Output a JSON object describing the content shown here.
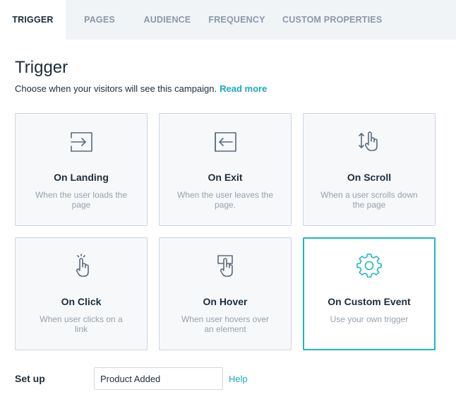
{
  "tabs": [
    {
      "label": "TRIGGER",
      "active": true
    },
    {
      "label": "PAGES",
      "active": false
    },
    {
      "label": "AUDIENCE",
      "active": false
    },
    {
      "label": "FREQUENCY",
      "active": false
    },
    {
      "label": "CUSTOM PROPERTIES",
      "active": false
    }
  ],
  "header": {
    "title": "Trigger",
    "subtitle": "Choose when your visitors will see this campaign.",
    "read_more": "Read more"
  },
  "triggers": [
    {
      "title": "On Landing",
      "desc": "When the user loads the page",
      "icon": "enter-icon",
      "selected": false
    },
    {
      "title": "On Exit",
      "desc": "When the user leaves the page.",
      "icon": "exit-icon",
      "selected": false
    },
    {
      "title": "On Scroll",
      "desc": "When a user scrolls down the page",
      "icon": "scroll-hand-icon",
      "selected": false
    },
    {
      "title": "On Click",
      "desc": "When user clicks on a link",
      "icon": "click-hand-icon",
      "selected": false
    },
    {
      "title": "On Hover",
      "desc": "When user hovers over an element",
      "icon": "hover-hand-icon",
      "selected": false
    },
    {
      "title": "On Custom Event",
      "desc": "Use your own trigger",
      "icon": "gear-icon",
      "selected": true
    }
  ],
  "setup": {
    "label": "Set up",
    "value": "Product Added",
    "help": "Help"
  },
  "colors": {
    "accent": "#1fb5c4",
    "link": "#1aa9bc",
    "icon": "#5b6b7c",
    "text": "#1d2d3a",
    "muted": "#97a2ad"
  }
}
